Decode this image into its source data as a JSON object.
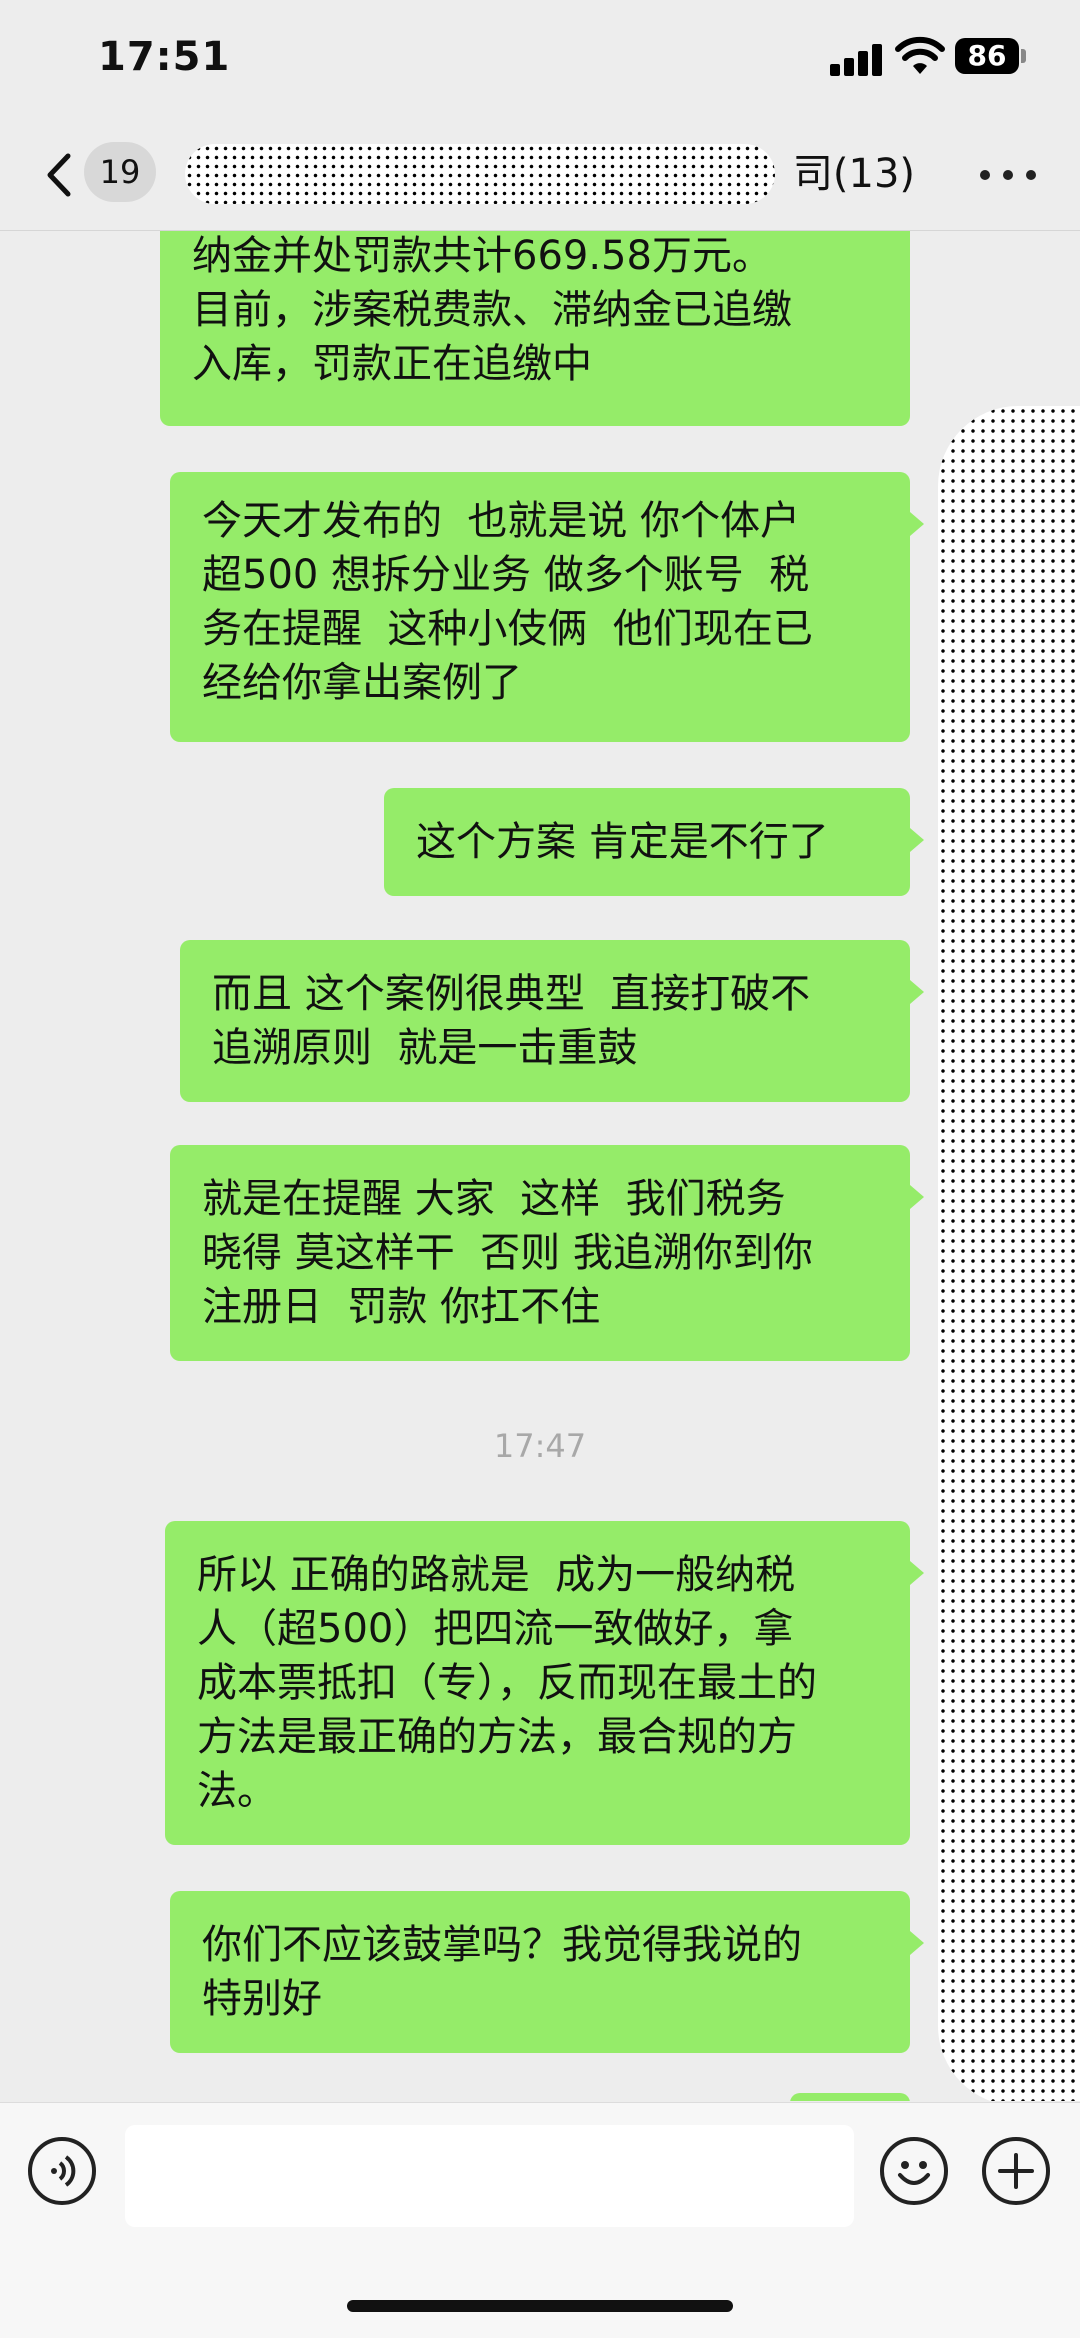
{
  "status_bar": {
    "time": "17:51",
    "battery": "86"
  },
  "nav": {
    "back_count": "19",
    "title_visible": "司(13)"
  },
  "messages": [
    {
      "text": "纳金并处罚款共计669.58万元。\n目前，涉案税费款、滞纳金已追缴\n入库，罚款正在追缴中"
    },
    {
      "text": "今天才发布的  也就是说 你个体户\n超500 想拆分业务 做多个账号  税\n务在提醒  这种小伎俩  他们现在已\n经给你拿出案例了"
    },
    {
      "text": "这个方案 肯定是不行了"
    },
    {
      "text": "而且 这个案例很典型  直接打破不\n追溯原则  就是一击重鼓"
    },
    {
      "text": "就是在提醒 大家  这样  我们税务\n晓得 莫这样干  否则 我追溯你到你\n注册日  罚款 你扛不住"
    },
    {
      "text": "所以 正确的路就是  成为一般纳税\n人（超500）把四流一致做好，拿\n成本票抵扣（专），反而现在最土的\n方法是最正确的方法，最合规的方\n法。"
    },
    {
      "text": "你们不应该鼓掌吗？我觉得我说的\n特别好"
    }
  ],
  "timestamp": "17:47",
  "icons": {
    "back": "chevron-left-icon",
    "more": "more-dots-icon",
    "voice": "voice-icon",
    "emoji": "emoji-icon",
    "plus": "plus-icon"
  },
  "colors": {
    "bubble": "#95ec69",
    "background": "#ededed"
  }
}
